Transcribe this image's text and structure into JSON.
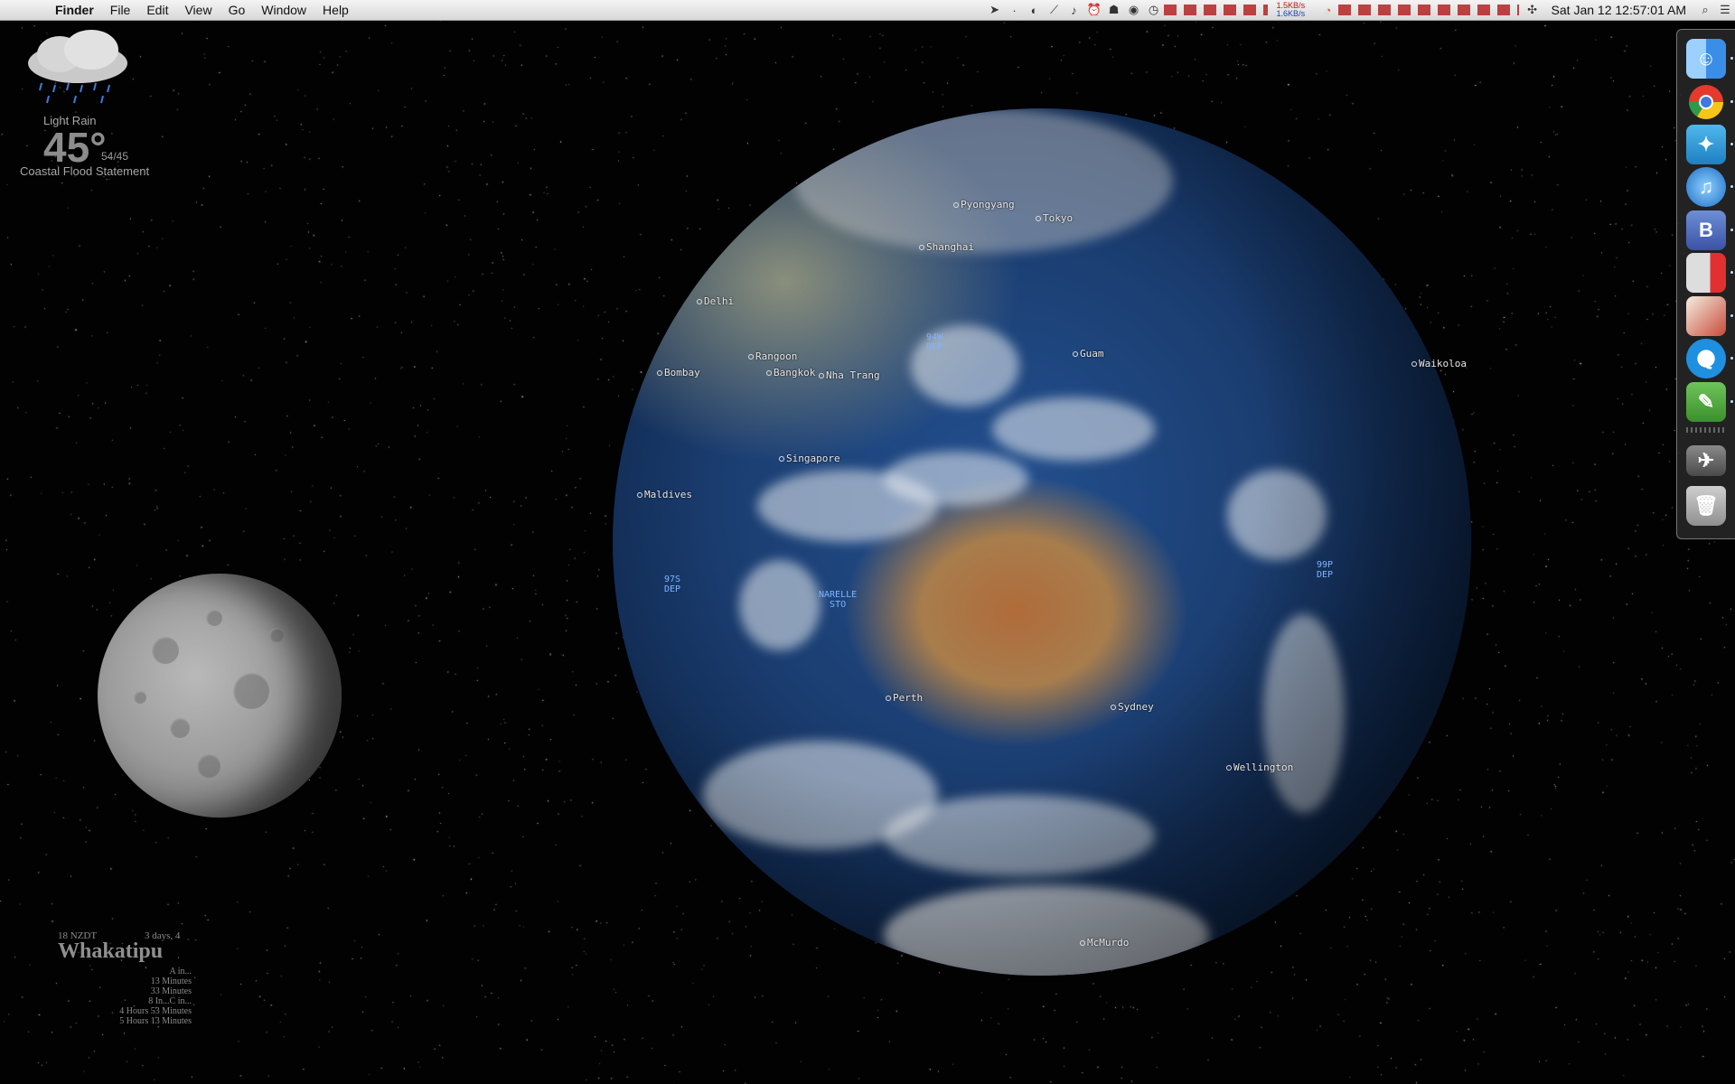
{
  "menubar": {
    "apple_icon": "apple-logo",
    "app_name": "Finder",
    "menus": [
      "File",
      "Edit",
      "View",
      "Go",
      "Window",
      "Help"
    ],
    "net_up": "1.5KB/s",
    "net_down": "1.6KB/s",
    "clock": "Sat Jan 12  12:57:01 AM"
  },
  "weather": {
    "condition": "Light Rain",
    "temperature": "45°",
    "hilo": "54/45",
    "alert": "Coastal Flood Statement"
  },
  "tide": {
    "timezone": "18 NZDT",
    "days": "3 days, 4",
    "place": "Whakatipu",
    "lines": [
      "A in...",
      "13 Minutes",
      "33 Minutes",
      "8 In...C in...",
      "4 Hours 53 Minutes",
      "5 Hours 13 Minutes"
    ]
  },
  "cities": [
    "Pyongyang",
    "Tokyo",
    "Shanghai",
    "Delhi",
    "Rangoon",
    "Bangkok",
    "Nha Trang",
    "Bombay",
    "Guam",
    "Waikoloa",
    "Singapore",
    "Maldives",
    "Perth",
    "Sydney",
    "Wellington",
    "McMurdo"
  ],
  "storms": [
    {
      "l1": "94W",
      "l2": "DEP"
    },
    {
      "l1": "97S",
      "l2": "DEP"
    },
    {
      "l1": "NARELLE",
      "l2": "STO"
    },
    {
      "l1": "99P",
      "l2": "DEP"
    }
  ],
  "dock": [
    "finder",
    "chrome",
    "twitter",
    "itunes",
    "bbedit",
    "monitor",
    "preview",
    "quicktime",
    "evernote",
    "downloads",
    "trash"
  ]
}
